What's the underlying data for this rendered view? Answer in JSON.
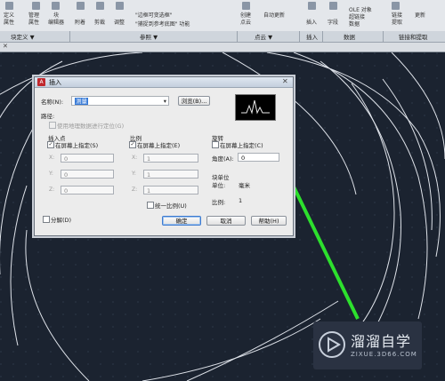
{
  "ribbon": {
    "items": [
      "定义",
      "属性",
      "管理",
      "属性",
      "块",
      "编辑器",
      "附着",
      "剪裁",
      "调整",
      "\"边框可变选框\"",
      "\"捕捉到参考底图\" 功能",
      "创建",
      "点云",
      "自动更新",
      "插入",
      "字段",
      "OLE 对象",
      "超链接",
      "数据",
      "链接",
      "提取",
      "更新"
    ],
    "partial_top": [
      "块定义 ▾",
      "参照 ▾",
      "点云 ▾",
      "插入",
      "数据",
      "链接和提取"
    ]
  },
  "panels": {
    "block_def": "块定义 ▼",
    "reference": "参照 ▼",
    "pointcloud": "点云 ▼",
    "insert": "插入",
    "data": "数据",
    "link": "链接和提取"
  },
  "dialog": {
    "title": "插入",
    "name_label": "名称(N):",
    "name_value": "测量",
    "browse_label": "浏览(B)...",
    "path_label": "路径:",
    "geo_label": "使用地理数据进行定位(G)",
    "insertion": {
      "title": "插入点",
      "onscreen": "在屏幕上指定(S)",
      "x_label": "X:",
      "x_value": "0",
      "y_label": "Y:",
      "y_value": "0",
      "z_label": "Z:",
      "z_value": "0"
    },
    "scale": {
      "title": "比例",
      "onscreen": "在屏幕上指定(E)",
      "x_label": "X:",
      "x_value": "1",
      "y_label": "Y:",
      "y_value": "1",
      "z_label": "Z:",
      "z_value": "1",
      "uniform": "统一比例(U)"
    },
    "rotation": {
      "title": "旋转",
      "onscreen": "在屏幕上指定(C)",
      "angle_label": "角度(A):",
      "angle_value": "0"
    },
    "block_unit": {
      "title": "块单位",
      "unit_label": "单位:",
      "unit_value": "毫米",
      "factor_label": "比例:",
      "factor_value": "1"
    },
    "explode_label": "分解(D)",
    "ok_label": "确定",
    "cancel_label": "取消",
    "help_label": "帮助(H)"
  },
  "watermark": {
    "title": "溜溜自学",
    "url": "ZIXUE.3D66.COM"
  },
  "colors": {
    "canvas": "#1b2330",
    "arrow": "#2de02d",
    "dialog_bg": "#ececec"
  }
}
